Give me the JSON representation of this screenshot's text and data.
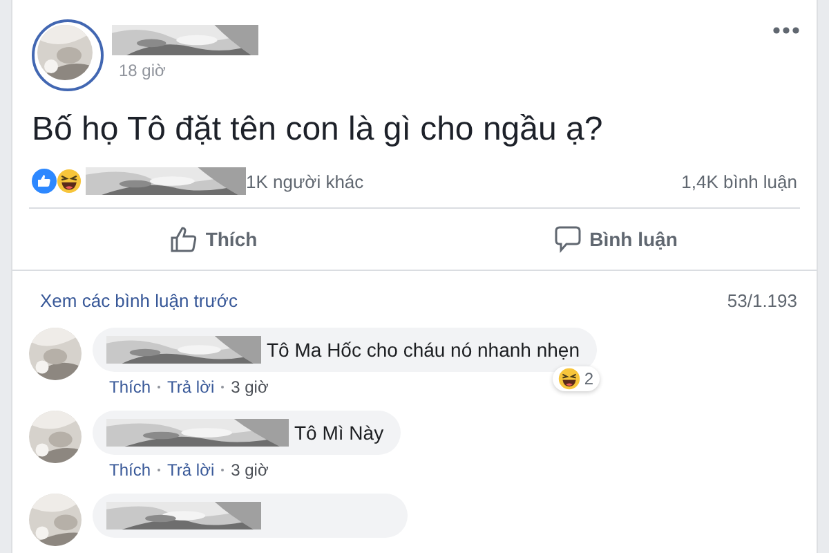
{
  "post": {
    "time": "18 giờ",
    "text": "Bố họ Tô đặt tên con là gì cho ngầu ạ?",
    "reactions_text": "1K người khác",
    "comments_count": "1,4K bình luận"
  },
  "actions": [
    {
      "kind": "like",
      "label": "Thích"
    },
    {
      "kind": "comment",
      "label": "Bình luận"
    }
  ],
  "comments_header": {
    "link": "Xem các bình luận trước",
    "count": "53/1.193"
  },
  "comments": [
    {
      "kind": "full",
      "text": "Tô Ma Hốc cho cháu nó nhanh nhẹn",
      "reaction_count": "2",
      "actions": [
        "Thích",
        "Trả lời",
        "3 giờ"
      ]
    },
    {
      "kind": "full",
      "text": "Tô Mì Này",
      "actions": [
        "Thích",
        "Trả lời",
        "3 giờ"
      ]
    },
    {
      "kind": "cut"
    }
  ]
}
